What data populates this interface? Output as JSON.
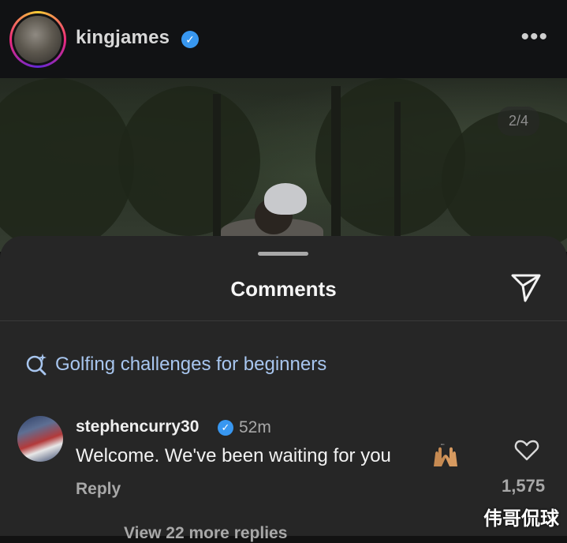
{
  "post": {
    "username": "kingjames",
    "more_icon": "ellipsis-horizontal-icon",
    "page_indicator": "2/4"
  },
  "comments_sheet": {
    "title": "Comments",
    "share_icon": "send-icon",
    "suggestion": {
      "icon": "ai-search-icon",
      "text": "Golfing challenges for beginners"
    },
    "comment": {
      "username": "stephencurry30",
      "verified": true,
      "time": "52m",
      "text": "Welcome. We've been waiting for you",
      "emoji": "raising-hands-emoji",
      "reply_label": "Reply",
      "like_count": "1,575",
      "view_replies_label": "View 22 more replies"
    }
  },
  "watermark": "伟哥侃球",
  "colors": {
    "background": "#121212",
    "sheet": "#262626",
    "link": "#a8c6ef",
    "verified": "#3897f0",
    "muted": "#a8a8a8"
  }
}
